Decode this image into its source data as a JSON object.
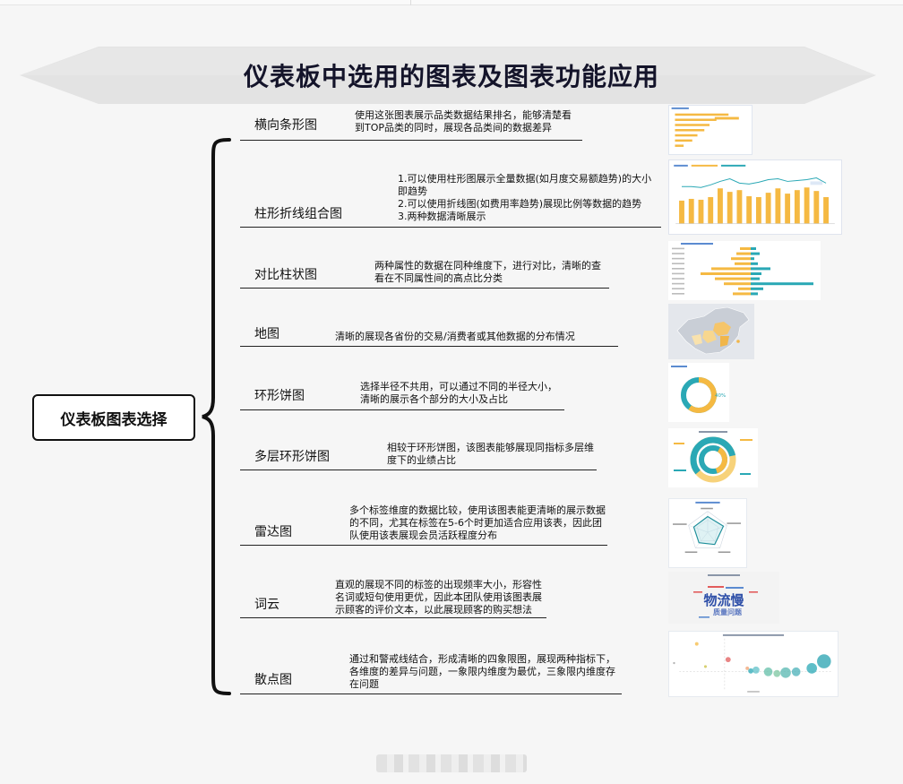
{
  "title": "仪表板中选用的图表及图表功能应用",
  "root": "仪表板图表选择",
  "items": [
    {
      "label": "横向条形图",
      "lines": [
        "使用这张图表展示品类数据结果排名，能够清楚看",
        "到TOP品类的同时，展现各品类间的数据差异"
      ]
    },
    {
      "label": "柱形折线组合图",
      "lines": [
        "1.可以使用柱形图展示全量数据(如月度交易额趋势)的大小",
        "即趋势",
        "2.可以使用折线图(如费用率趋势)展现比例等数据的趋势",
        "3.两种数据清晰展示"
      ]
    },
    {
      "label": "对比柱状图",
      "lines": [
        "两种属性的数据在同种维度下，进行对比，清晰的查",
        "看在不同属性间的高点比分类"
      ]
    },
    {
      "label": "地图",
      "lines": [
        "清晰的展现各省份的交易/消费者或其他数据的分布情况"
      ]
    },
    {
      "label": "环形饼图",
      "lines": [
        "选择半径不共用，可以通过不同的半径大小，",
        "清晰的展示各个部分的大小及占比"
      ]
    },
    {
      "label": "多层环形饼图",
      "lines": [
        "相较于环形饼图，该图表能够展现同指标多层维",
        "度下的业绩占比"
      ]
    },
    {
      "label": "雷达图",
      "lines": [
        "多个标签维度的数据比较，使用该图表能更清晰的展示数据",
        "的不同，尤其在标签在5-6个时更加适合应用该表，因此团",
        "队使用该表展现会员活跃程度分布"
      ]
    },
    {
      "label": "词云",
      "lines": [
        "直观的展现不同的标签的出现频率大小，形容性",
        "名词或短句使用更优，因此本团队使用该图表展",
        "示顾客的评价文本，以此展现顾客的购买想法"
      ]
    },
    {
      "label": "散点图",
      "lines": [
        "通过和警戒线结合，形成清晰的四象限图，展现两种指标下，",
        "各维度的差异与问题，一象限内维度为最优，三象限内维度存",
        "在问题"
      ]
    }
  ],
  "thumbs": {
    "ring_percent": "40%",
    "wordcloud_main": "物流慢",
    "wordcloud_sub": "质量问题"
  }
}
